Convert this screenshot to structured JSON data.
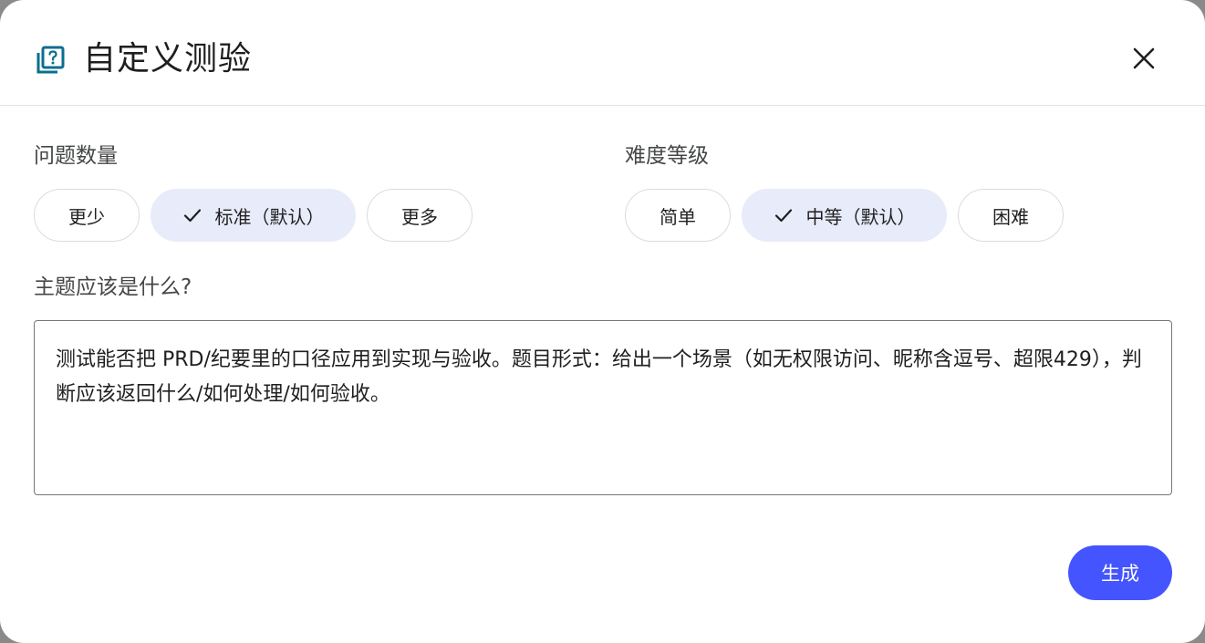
{
  "dialog": {
    "title": "自定义测验",
    "icon": "quiz-icon",
    "close_icon": "close-icon"
  },
  "question_count": {
    "label": "问题数量",
    "options": [
      {
        "label": "更少",
        "selected": false
      },
      {
        "label": "标准（默认）",
        "selected": true
      },
      {
        "label": "更多",
        "selected": false
      }
    ]
  },
  "difficulty": {
    "label": "难度等级",
    "options": [
      {
        "label": "简单",
        "selected": false
      },
      {
        "label": "中等（默认）",
        "selected": true
      },
      {
        "label": "困难",
        "selected": false
      }
    ]
  },
  "topic": {
    "label": "主题应该是什么?",
    "value": "测试能否把 PRD/纪要里的口径应用到实现与验收。题目形式：给出一个场景（如无权限访问、昵称含逗号、超限429），判断应该返回什么/如何处理/如何验收。"
  },
  "actions": {
    "generate_label": "生成"
  },
  "colors": {
    "accent": "#4454ff",
    "selected_chip": "#e8ebfa",
    "icon": "#0b6e8f"
  }
}
